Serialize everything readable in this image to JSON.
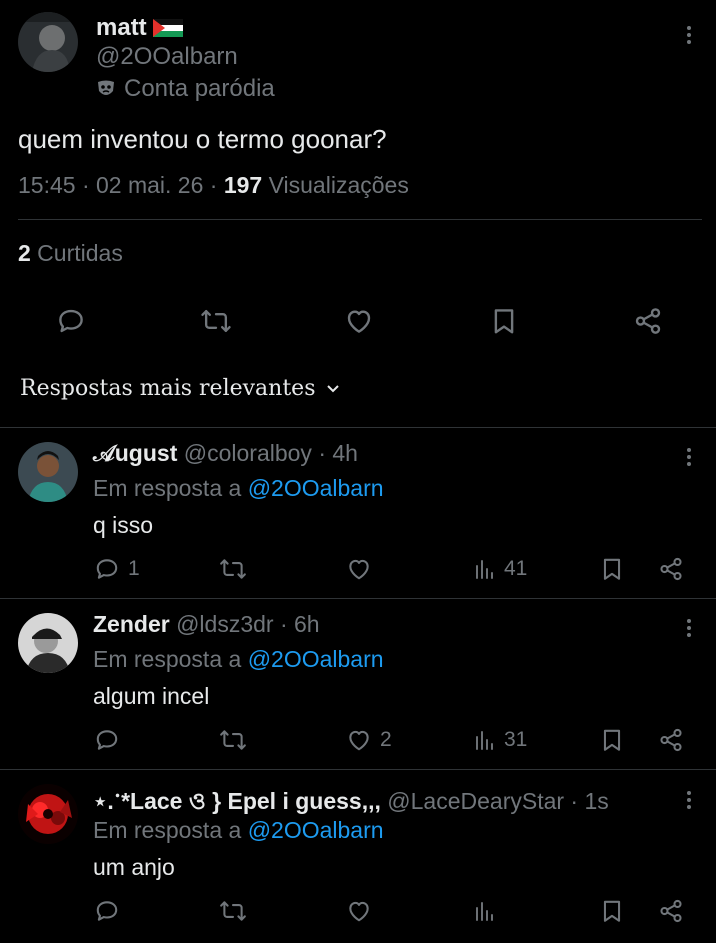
{
  "tweet": {
    "author_name": "matt",
    "author_handle": "@2OOalbarn",
    "parody_label": "Conta paródia",
    "text": "quem inventou o termo goonar?",
    "time_date": "15:45 · 02 mai. 26 · ",
    "views_count": "197",
    "views_label": " Visualizações",
    "likes_count": "2",
    "likes_label": " Curtidas"
  },
  "sort_label": "Respostas mais relevantes",
  "replies": [
    {
      "name": "𝒜ugust",
      "handle": "@coloralboy",
      "time": " · 4h",
      "reply_to_label": "Em resposta a ",
      "reply_to_handle": "@2OOalbarn",
      "text": "q isso",
      "replies_count": "1",
      "retweets_count": "",
      "likes_count": "",
      "views_count": "41"
    },
    {
      "name": "Zender",
      "handle": "@ldsz3dr",
      "time": " · 6h",
      "reply_to_label": "Em resposta a ",
      "reply_to_handle": "@2OOalbarn",
      "text": "algum incel",
      "replies_count": "",
      "retweets_count": "",
      "likes_count": "2",
      "views_count": "31"
    },
    {
      "name": "⋆.ॱ*Lace ও } Epel i guess,,,",
      "handle": "@LaceDearyStar",
      "time": " · 1s",
      "reply_to_label": "Em resposta a ",
      "reply_to_handle": "@2OOalbarn",
      "text": "um anjo",
      "replies_count": "",
      "retweets_count": "",
      "likes_count": "",
      "views_count": ""
    }
  ],
  "colors": {
    "background": "#000000",
    "text": "#e7e9ea",
    "muted": "#71767b",
    "link": "#1d9bf0",
    "divider": "#2f3336"
  }
}
